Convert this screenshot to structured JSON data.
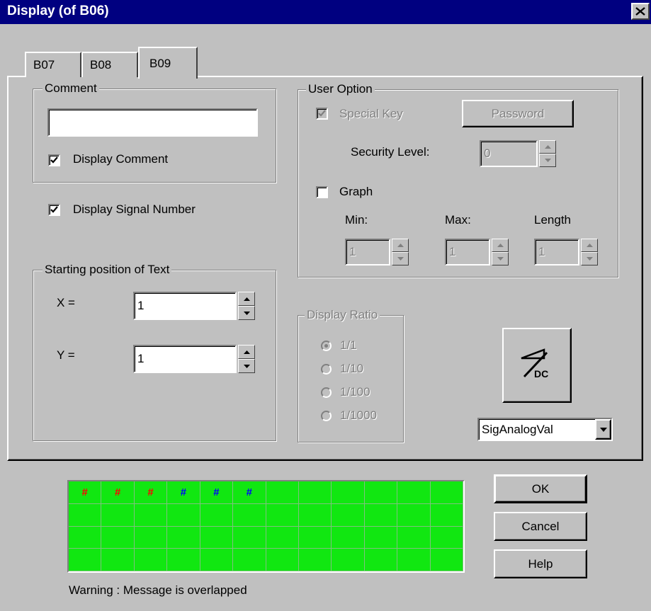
{
  "window": {
    "title": "Display (of B06)"
  },
  "tabs": [
    {
      "label": "B07"
    },
    {
      "label": "B08"
    },
    {
      "label": "B09"
    }
  ],
  "comment_group": {
    "legend": "Comment",
    "value": "",
    "display_comment_label": "Display Comment",
    "display_comment_checked": true
  },
  "display_signal_number": {
    "label": "Display Signal Number",
    "checked": true
  },
  "position_group": {
    "legend": "Starting position of Text",
    "x_label": "X =",
    "x_value": "1",
    "y_label": "Y =",
    "y_value": "1"
  },
  "user_option": {
    "legend": "User Option",
    "special_key_label": "Special Key",
    "special_key_checked": true,
    "password_label": "Password",
    "security_level_label": "Security Level:",
    "security_level_value": "0",
    "graph_label": "Graph",
    "graph_checked": false,
    "min_label": "Min:",
    "min_value": "1",
    "max_label": "Max:",
    "max_value": "1",
    "length_label": "Length",
    "length_value": "1"
  },
  "display_ratio": {
    "legend": "Display Ratio",
    "options": [
      "1/1",
      "1/10",
      "1/100",
      "1/1000"
    ],
    "selected": "1/1"
  },
  "signal_icon": {
    "name": "analog-dc-icon",
    "text": "DC"
  },
  "signal_type_select": {
    "value": "SigAnalogVal"
  },
  "preview": {
    "markers": [
      {
        "text": "#",
        "color": "#ff0000"
      },
      {
        "text": "#",
        "color": "#ff0000"
      },
      {
        "text": "#",
        "color": "#ff0000"
      },
      {
        "text": "#",
        "color": "#0000ff"
      },
      {
        "text": "#",
        "color": "#0000ff"
      },
      {
        "text": "#",
        "color": "#0000ff"
      }
    ],
    "background_color": "#11e711"
  },
  "buttons": {
    "ok": "OK",
    "cancel": "Cancel",
    "help": "Help"
  },
  "warning": "Warning : Message is overlapped"
}
